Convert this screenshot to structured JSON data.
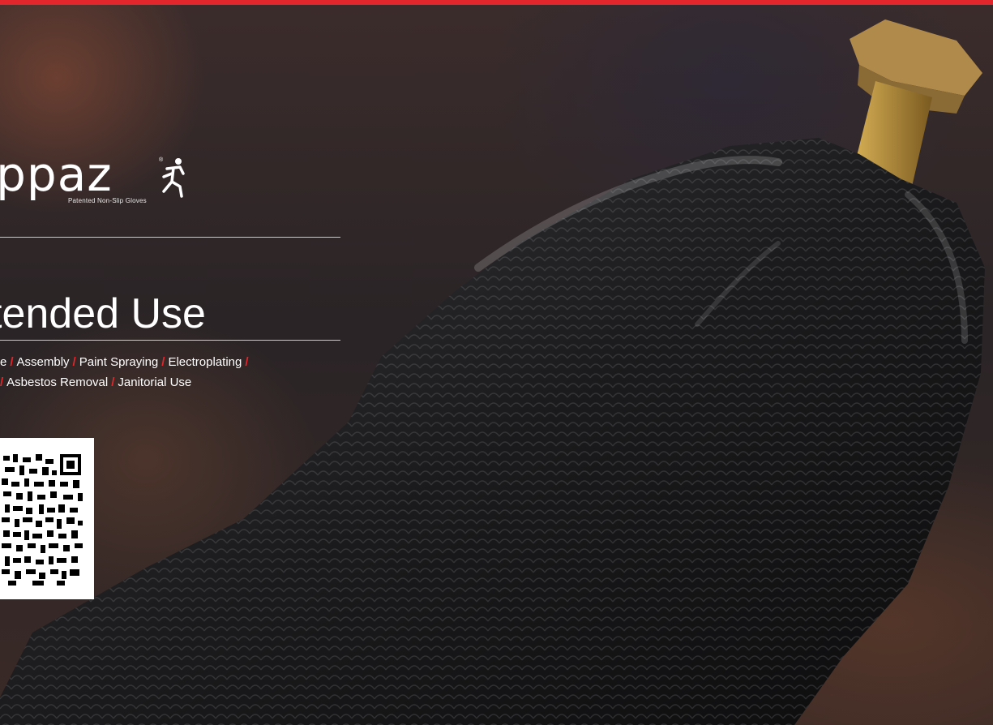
{
  "brand": {
    "logo_text": "ippaz",
    "registered_mark": "®",
    "tagline": "Patented Non-Slip Gloves"
  },
  "page": {
    "title": "tended Use"
  },
  "uses": {
    "line1": [
      "e",
      "Assembly",
      "Paint Spraying",
      "Electroplating",
      ""
    ],
    "line2": [
      "",
      "Asbestos Removal",
      "Janitorial Use"
    ],
    "separator": "/"
  },
  "colors": {
    "accent": "#e3262b",
    "text": "#ffffff",
    "background": "#1c1a1c"
  },
  "icons": {
    "mascot": "running-figure-icon",
    "qr": "qr-code"
  }
}
